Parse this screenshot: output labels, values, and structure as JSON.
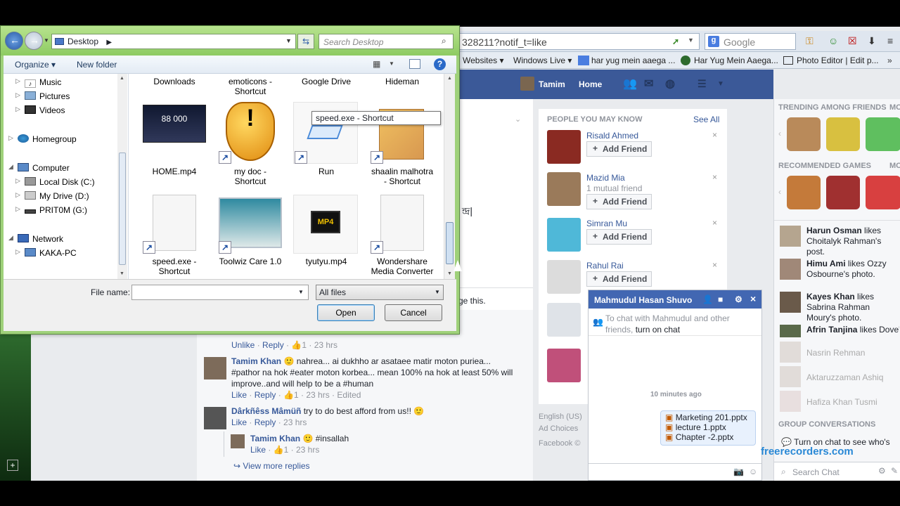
{
  "browser": {
    "url_fragment": "328211?notif_t=like",
    "search_placeholder": "Google",
    "favorites": [
      "Websites ▾",
      "Windows Live ▾",
      "har yug mein aaega ...",
      "Har Yug Mein Aaega...",
      "Photo Editor | Edit p..."
    ]
  },
  "facebook": {
    "user_name": "Tamim",
    "home_label": "Home",
    "pymk": {
      "header": "PEOPLE YOU MAY KNOW",
      "see_all": "See All",
      "add_friend_label": "Add Friend",
      "people": [
        {
          "name": "Risald Ahmed",
          "sub": ""
        },
        {
          "name": "Mazid Mia",
          "sub": "1 mutual friend"
        },
        {
          "name": "Simran Mu",
          "sub": ""
        },
        {
          "name": "Rahul Rai",
          "sub": ""
        }
      ]
    },
    "footer": [
      "English (US)",
      "Ad Choices",
      "Facebook ©"
    ],
    "feed": {
      "partial_text": "ge this.",
      "bengali_fragment": "ন্দ্র|",
      "top_actions": {
        "unlike": "Unlike",
        "reply": "Reply",
        "likes": "1",
        "time": "23 hrs"
      },
      "comments": [
        {
          "author": "Tamim Khan",
          "text": "🙂 nahrea... ai dukhho ar asataee matir moton puriea... #pathor na hok #eater moton korbea... mean 100% na hok at least 50% will improve..and will help to be a #human",
          "like": "Like",
          "reply": "Reply",
          "likes": "1",
          "time": "23 hrs",
          "edited": "Edited"
        },
        {
          "author": "Dârkñêss Mâmüñ",
          "text": "try to do best afford from us!! 🙂",
          "like": "Like",
          "reply": "Reply",
          "time": "23 hrs"
        },
        {
          "author": "Tamim Khan",
          "text": "🙂 #insallah",
          "like": "Like",
          "likes": "1",
          "time": "23 hrs"
        }
      ],
      "view_more": "View more replies"
    },
    "right": {
      "trending_header": "TRENDING AMONG FRIENDS",
      "trending_more": "MO",
      "games_header": "RECOMMENDED GAMES",
      "games_more": "MO",
      "ticker": [
        {
          "name": "Harun Osman",
          "text": " likes Choitalyk Rahman's post."
        },
        {
          "name": "Himu Ami",
          "text": " likes Ozzy Osbourne's photo."
        },
        {
          "name": "Kayes Khan",
          "text": " likes Sabrina Rahman Moury's photo."
        },
        {
          "name": "Afrin Tanjina",
          "text": " likes Dove's"
        }
      ],
      "online": [
        "Nasrin Rehman",
        "Aktaruzzaman Ashiq",
        "Hafiza Khan Tusmi"
      ],
      "group_header": "GROUP CONVERSATIONS",
      "turn_on_chat": "Turn on chat to see who's",
      "search_chat": "Search Chat"
    },
    "chat": {
      "title": "Mahmudul Hasan Shuvo",
      "notice": "To chat with Mahmudul and other friends, ",
      "notice_link": "turn on chat",
      "time": "10 minutes ago",
      "files": [
        "Marketing 201.pptx",
        "lecture 1.pptx",
        "Chapter -2.pptx"
      ]
    }
  },
  "watermark": "freerecorders.com",
  "dialog": {
    "path": "Desktop",
    "search_placeholder": "Search Desktop",
    "organize": "Organize ▾",
    "new_folder": "New folder",
    "tree": {
      "music": "Music",
      "pictures": "Pictures",
      "videos": "Videos",
      "homegroup": "Homegroup",
      "computer": "Computer",
      "local_disk": "Local Disk (C:)",
      "my_drive": "My Drive (D:)",
      "pritom": "PRIT0M (G:)",
      "network": "Network",
      "kaka_pc": "KAKA-PC"
    },
    "files_row0": [
      "Downloads",
      "emoticons -\nShortcut",
      "Google Drive",
      "Hideman"
    ],
    "files_row1": [
      "HOME.mp4",
      "my doc -\nShortcut",
      "Run",
      "shaalin malhotra\n- Shortcut"
    ],
    "files_row2": [
      "speed.exe -\nShortcut",
      "Toolwiz Care 1.0",
      "tyutyu.mp4",
      "Wondershare\nMedia Converter"
    ],
    "video_thumb_text": "88 000",
    "mp4_label": "MP4",
    "tooltip": "speed.exe - Shortcut",
    "file_name_label": "File name:",
    "file_name_value": "",
    "filter": "All files",
    "open": "Open",
    "cancel": "Cancel"
  }
}
